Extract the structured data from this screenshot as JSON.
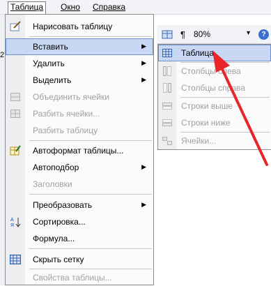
{
  "menubar": {
    "items": [
      {
        "label": "Таблица"
      },
      {
        "label": "Окно"
      },
      {
        "label": "Справка"
      }
    ]
  },
  "toolbar": {
    "pilcrow": "¶",
    "zoom": "80%",
    "dropdown_arrow": "▾",
    "help_glyph": "?",
    "edge_char": "2"
  },
  "table_menu": {
    "items": [
      {
        "label": "Нарисовать таблицу",
        "icon": "pencil-icon",
        "enabled": true
      },
      {
        "label": "Вставить",
        "submenu": true,
        "enabled": true,
        "highlighted": true
      },
      {
        "label": "Удалить",
        "submenu": true,
        "enabled": true
      },
      {
        "label": "Выделить",
        "submenu": true,
        "enabled": true
      },
      {
        "label": "Объединить ячейки",
        "icon": "merge-cells-icon",
        "enabled": false
      },
      {
        "label": "Разбить ячейки...",
        "icon": "split-cells-icon",
        "enabled": false
      },
      {
        "label": "Разбить таблицу",
        "enabled": false
      },
      {
        "label": "Автоформат таблицы...",
        "icon": "autoformat-icon",
        "enabled": true
      },
      {
        "label": "Автоподбор",
        "submenu": true,
        "enabled": true
      },
      {
        "label": "Заголовки",
        "enabled": false
      },
      {
        "label": "Преобразовать",
        "submenu": true,
        "enabled": true
      },
      {
        "label": "Сортировка...",
        "icon": "sort-az-icon",
        "enabled": true
      },
      {
        "label": "Формула...",
        "enabled": true
      },
      {
        "label": "Скрыть сетку",
        "icon": "grid-icon",
        "enabled": true
      },
      {
        "label": "Свойства таблицы...",
        "enabled": false
      }
    ]
  },
  "insert_submenu": {
    "items": [
      {
        "label": "Таблица",
        "icon": "table-icon",
        "enabled": true,
        "highlighted": true
      },
      {
        "label": "Столбцы слева",
        "icon": "columns-left-icon",
        "enabled": false
      },
      {
        "label": "Столбцы справа",
        "icon": "columns-right-icon",
        "enabled": false
      },
      {
        "label": "Строки выше",
        "icon": "rows-above-icon",
        "enabled": false
      },
      {
        "label": "Строки ниже",
        "icon": "rows-below-icon",
        "enabled": false
      },
      {
        "label": "Ячейки...",
        "icon": "cells-icon",
        "enabled": false
      }
    ]
  },
  "colors": {
    "highlight_bg": "#c8d8f4",
    "highlight_border": "#6d8fd0",
    "annotation_arrow": "#e8262a"
  }
}
